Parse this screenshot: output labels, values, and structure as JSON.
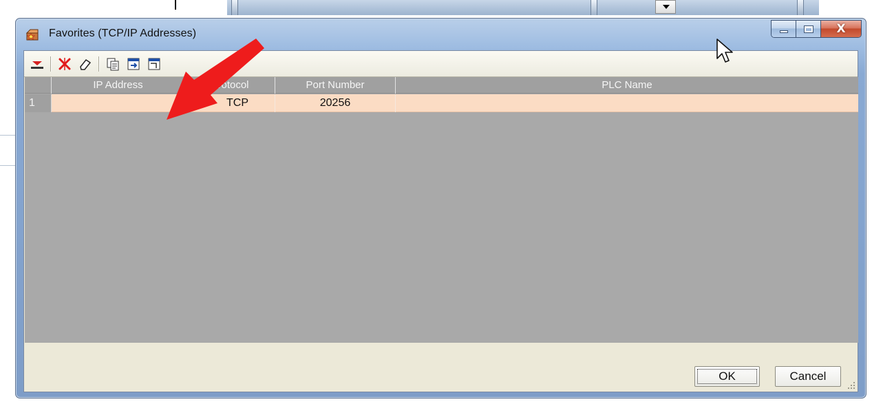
{
  "window": {
    "title": "Favorites (TCP/IP Addresses)",
    "icons": {
      "app": "favorites-box-icon",
      "minimize": "minimize-icon",
      "maximize": "maximize-icon",
      "close": "close-icon"
    },
    "close_glyph": "X"
  },
  "toolbar": {
    "buttons": [
      {
        "name": "add-favorite-button",
        "icon": "add-row-icon"
      },
      {
        "name": "delete-favorite-button",
        "icon": "delete-x-icon"
      },
      {
        "name": "clear-button",
        "icon": "eraser-icon"
      },
      {
        "name": "copy-button",
        "icon": "copy-icon"
      },
      {
        "name": "import-button",
        "icon": "import-icon"
      },
      {
        "name": "export-button",
        "icon": "export-icon"
      }
    ]
  },
  "grid": {
    "columns": [
      "IP Address",
      "Protocol",
      "Port Number",
      "PLC Name"
    ],
    "rows": [
      {
        "index": "1",
        "ip_address": "",
        "protocol": "TCP",
        "port_number": "20256",
        "plc_name": ""
      }
    ],
    "selected_row_color": "#fbdcc4",
    "empty_area_color": "#a9a9a9"
  },
  "buttons": {
    "ok_label": "OK",
    "cancel_label": "Cancel"
  },
  "annotation": {
    "type": "arrow",
    "color": "#ee1c1c",
    "icon": "red-arrow-annotation"
  },
  "colors": {
    "frame": "#89a9d3",
    "client": "#ece9d8",
    "close": "#c24a2d"
  }
}
